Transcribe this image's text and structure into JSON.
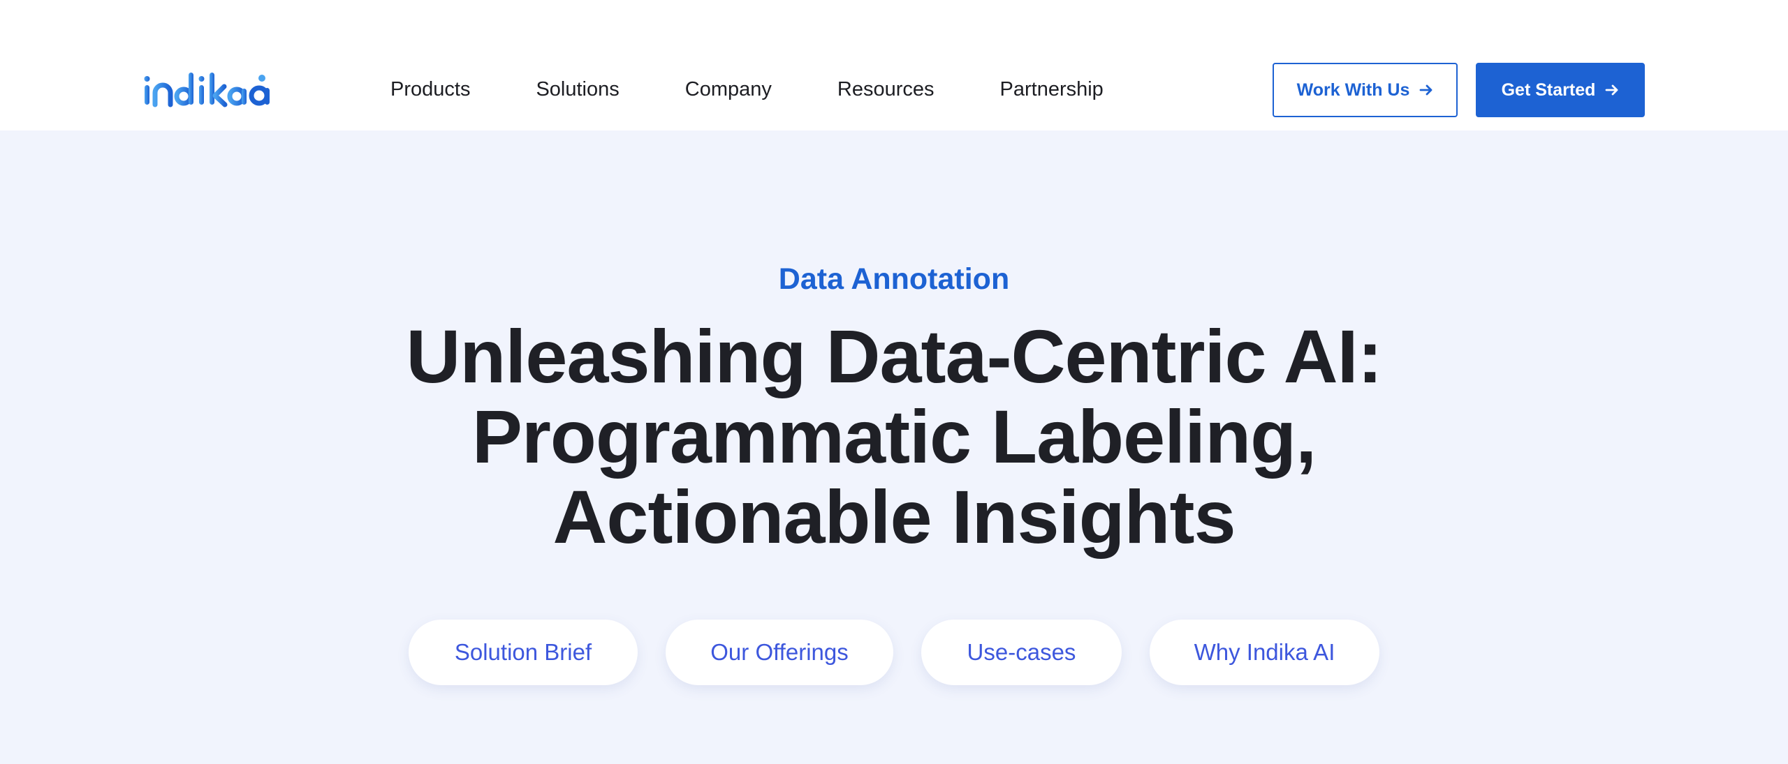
{
  "header": {
    "logo_text": "indikaai",
    "nav": [
      "Products",
      "Solutions",
      "Company",
      "Resources",
      "Partnership"
    ],
    "work_with_us_label": "Work With Us",
    "get_started_label": "Get Started",
    "icons": {
      "button_arrow": "arrow-right-icon"
    }
  },
  "hero": {
    "eyebrow": "Data Annotation",
    "headline_lines": [
      "Unleashing Data-Centric AI:",
      "Programmatic Labeling,",
      "Actionable Insights"
    ],
    "pills": [
      "Solution Brief",
      "Our Offerings",
      "Use-cases",
      "Why Indika AI"
    ]
  },
  "colors": {
    "brand_blue": "#1d62d3",
    "logo_light_blue": "#4aa3f0",
    "pill_text": "#3d57dd",
    "hero_background": "#f1f4fd",
    "heading_text": "#1f2026"
  }
}
